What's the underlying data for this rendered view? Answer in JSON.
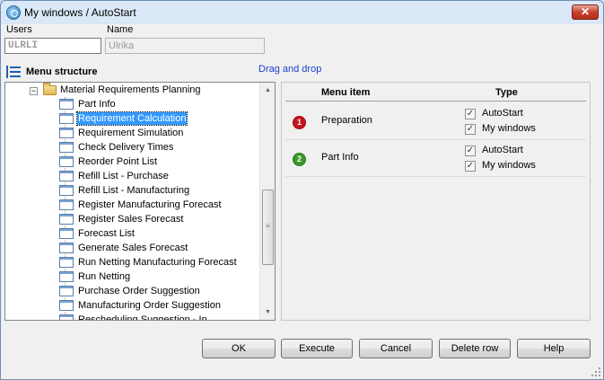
{
  "window": {
    "title": "My windows / AutoStart",
    "close_glyph": "✕"
  },
  "fields": {
    "users_label": "Users",
    "name_label": "Name",
    "user_code": "ULRLI",
    "user_name": "Ulrika"
  },
  "menu_structure": {
    "title": "Menu structure",
    "drag_hint": "Drag and drop",
    "parent": "Material Requirements Planning",
    "items": [
      "Part Info",
      "Requirement Calculation",
      "Requirement Simulation",
      "Check Delivery Times",
      "Reorder Point List",
      "Refill List - Purchase",
      "Refill List - Manufacturing",
      "Register Manufacturing Forecast",
      "Register Sales Forecast",
      "Forecast List",
      "Generate Sales Forecast",
      "Run Netting Manufacturing Forecast",
      "Run Netting",
      "Purchase Order Suggestion",
      "Manufacturing Order Suggestion",
      "Rescheduling Suggestion - In"
    ],
    "selected_item": "Requirement Calculation"
  },
  "grid": {
    "col_menu_item": "Menu item",
    "col_type": "Type",
    "rows": [
      {
        "number": "1",
        "badge_color": "#c8141e",
        "label": "Preparation",
        "autostart_label": "AutoStart",
        "mywindows_label": "My windows",
        "autostart_checked": true,
        "mywindows_checked": true
      },
      {
        "number": "2",
        "badge_color": "#3a9a2a",
        "label": "Part Info",
        "autostart_label": "AutoStart",
        "mywindows_label": "My windows",
        "autostart_checked": true,
        "mywindows_checked": true
      }
    ]
  },
  "buttons": {
    "ok": "OK",
    "execute": "Execute",
    "cancel": "Cancel",
    "delete_row": "Delete row",
    "help": "Help"
  },
  "glyphs": {
    "check": "✓",
    "minus": "−",
    "up_arrow": "▲",
    "down_arrow": "▼",
    "grip": "≡"
  }
}
